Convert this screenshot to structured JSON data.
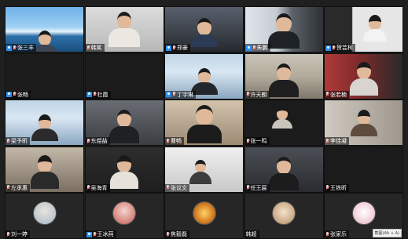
{
  "tiles": [
    {
      "name": "张三丰",
      "user_icon": true
    },
    {
      "name": "韩笑"
    },
    {
      "name": "郑豪",
      "user_icon": true
    },
    {
      "name": "朱鹏",
      "user_icon": true
    },
    {
      "name": "贺芸柯",
      "user_icon": true
    },
    {
      "name": "张畅",
      "user_icon": true
    },
    {
      "name": "杜霞",
      "user_icon": true
    },
    {
      "name": "丁宇琳",
      "user_icon": true
    },
    {
      "name": "许天朗"
    },
    {
      "name": "张若楠"
    },
    {
      "name": "梁予昕"
    },
    {
      "name": "东煜喆"
    },
    {
      "name": "曹畅"
    },
    {
      "name": "张一鸣"
    },
    {
      "name": "李佳凝"
    },
    {
      "name": "左承惠"
    },
    {
      "name": "吴海青"
    },
    {
      "name": "张议文"
    },
    {
      "name": "任王宸"
    },
    {
      "name": "王铁昕"
    },
    {
      "name": "刘一婷"
    },
    {
      "name": "王冰莼",
      "user_icon": true
    },
    {
      "name": "焦毅磊"
    },
    {
      "name": "韩超"
    },
    {
      "name": "张家乐"
    }
  ],
  "tooltip": "截图(Alt + A)"
}
